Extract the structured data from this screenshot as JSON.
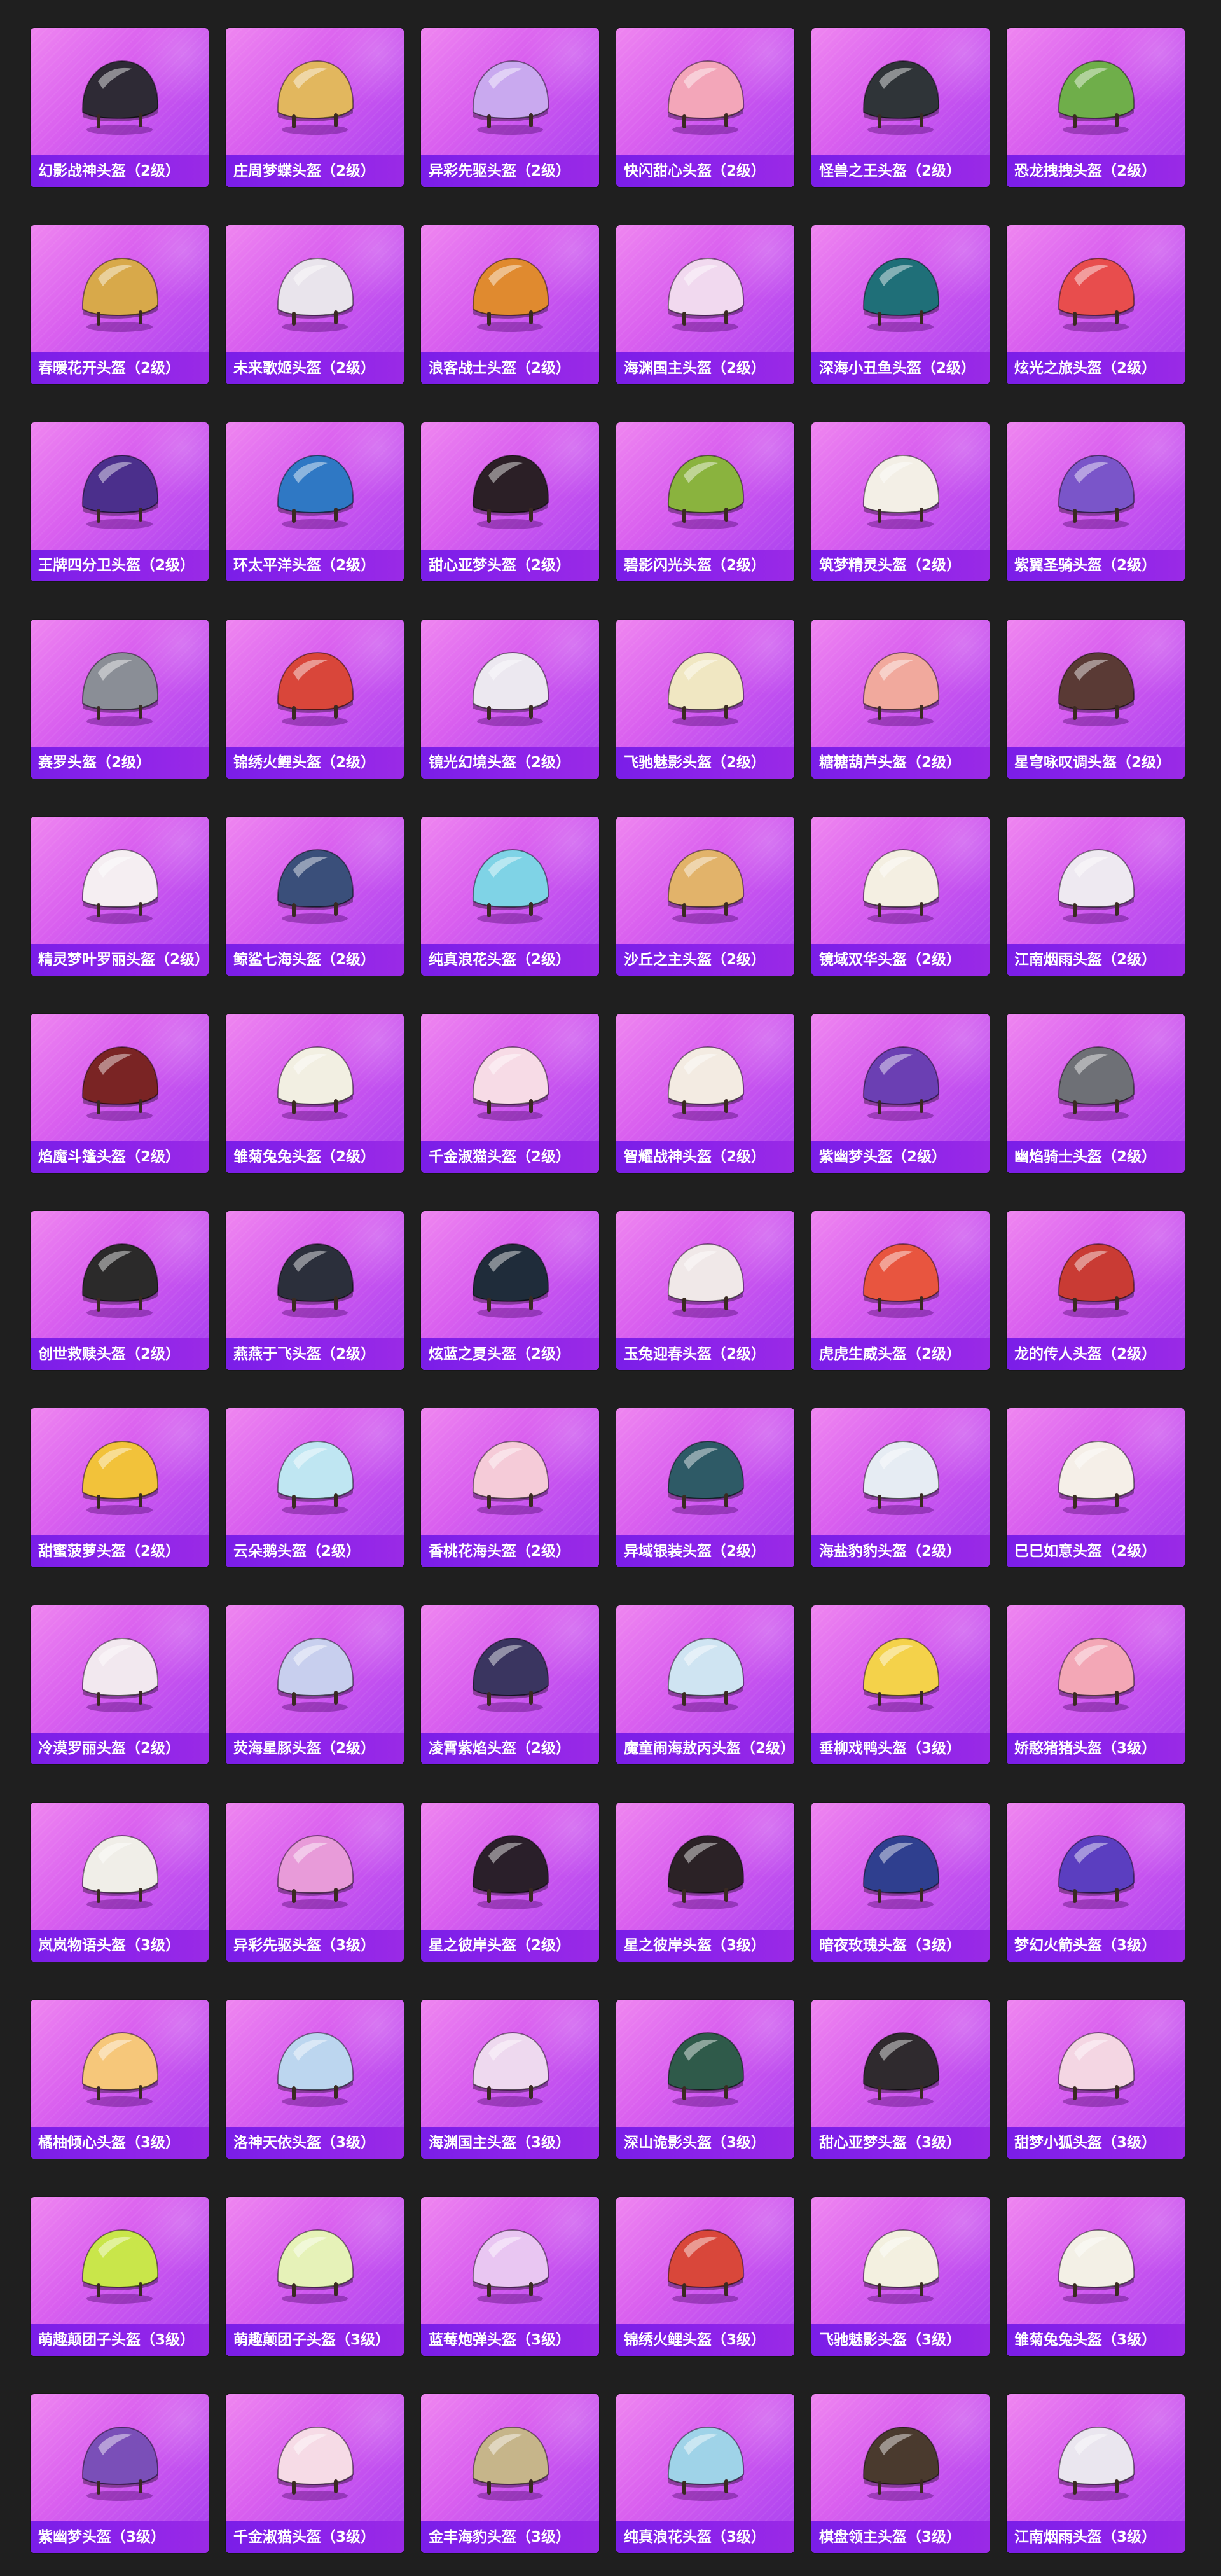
{
  "items": [
    {
      "name": "幻影战神头盔（2级）",
      "color": "#2e2a35"
    },
    {
      "name": "庄周梦蝶头盔（2级）",
      "color": "#e2b75e"
    },
    {
      "name": "异彩先驱头盔（2级）",
      "color": "#c9a9ef"
    },
    {
      "name": "快闪甜心头盔（2级）",
      "color": "#f3a6b9"
    },
    {
      "name": "怪兽之王头盔（2级）",
      "color": "#2f3438"
    },
    {
      "name": "恐龙拽拽头盔（2级）",
      "color": "#6fae4a"
    },
    {
      "name": "春暖花开头盔（2级）",
      "color": "#d8a94a"
    },
    {
      "name": "未来歌姬头盔（2级）",
      "color": "#e9e4ec"
    },
    {
      "name": "浪客战士头盔（2级）",
      "color": "#e08a2f"
    },
    {
      "name": "海渊国主头盔（2级）",
      "color": "#f1d9ef"
    },
    {
      "name": "深海小丑鱼头盔（2级）",
      "color": "#1f6f78"
    },
    {
      "name": "炫光之旅头盔（2级）",
      "color": "#e84d4d"
    },
    {
      "name": "王牌四分卫头盔（2级）",
      "color": "#4b2f8c"
    },
    {
      "name": "环太平洋头盔（2级）",
      "color": "#2f78c4"
    },
    {
      "name": "甜心亚梦头盔（2级）",
      "color": "#2b1f26"
    },
    {
      "name": "碧影闪光头盔（2级）",
      "color": "#8ab33e"
    },
    {
      "name": "筑梦精灵头盔（2级）",
      "color": "#f3efe6"
    },
    {
      "name": "紫翼圣骑头盔（2级）",
      "color": "#7a55c9"
    },
    {
      "name": "赛罗头盔（2级）",
      "color": "#8a8e96"
    },
    {
      "name": "锦绣火鲤头盔（2级）",
      "color": "#d9463a"
    },
    {
      "name": "镜光幻境头盔（2级）",
      "color": "#ece8f0"
    },
    {
      "name": "飞驰魅影头盔（2级）",
      "color": "#f0e7c2"
    },
    {
      "name": "糖糖葫芦头盔（2级）",
      "color": "#f1a99d"
    },
    {
      "name": "星穹咏叹调头盔（2级）",
      "color": "#5a3a35"
    },
    {
      "name": "精灵梦叶罗丽头盔（2级）",
      "color": "#f5eef2"
    },
    {
      "name": "鲸鲨七海头盔（2级）",
      "color": "#3a4f7a"
    },
    {
      "name": "纯真浪花头盔（2级）",
      "color": "#7fd3e6"
    },
    {
      "name": "沙丘之主头盔（2级）",
      "color": "#e2b36a"
    },
    {
      "name": "镜域双华头盔（2级）",
      "color": "#f4efe2"
    },
    {
      "name": "江南烟雨头盔（2级）",
      "color": "#eee9f1"
    },
    {
      "name": "焰魔斗篷头盔（2级）",
      "color": "#7a2424"
    },
    {
      "name": "雏菊兔兔头盔（2级）",
      "color": "#f2efe2"
    },
    {
      "name": "千金淑猫头盔（2级）",
      "color": "#f7dbe6"
    },
    {
      "name": "智耀战神头盔（2级）",
      "color": "#f3ebe2"
    },
    {
      "name": "紫幽梦头盔（2级）",
      "color": "#6b3fb3"
    },
    {
      "name": "幽焰骑士头盔（2级）",
      "color": "#6e7076"
    },
    {
      "name": "创世救赎头盔（2级）",
      "color": "#2b2a2a"
    },
    {
      "name": "燕燕于飞头盔（2级）",
      "color": "#2b2f3b"
    },
    {
      "name": "炫蓝之夏头盔（2级）",
      "color": "#1f2c3a"
    },
    {
      "name": "玉兔迎春头盔（2级）",
      "color": "#f0e8e8"
    },
    {
      "name": "虎虎生威头盔（2级）",
      "color": "#e8553f"
    },
    {
      "name": "龙的传人头盔（2级）",
      "color": "#c93b34"
    },
    {
      "name": "甜蜜菠萝头盔（2级）",
      "color": "#f2c23a"
    },
    {
      "name": "云朵鹅头盔（2级）",
      "color": "#bfe6f2"
    },
    {
      "name": "香桃花海头盔（2级）",
      "color": "#f5cbd8"
    },
    {
      "name": "异域银装头盔（2级）",
      "color": "#2e5a66"
    },
    {
      "name": "海盐豹豹头盔（2级）",
      "color": "#e6ecf3"
    },
    {
      "name": "巳巳如意头盔（2级）",
      "color": "#f5efe8"
    },
    {
      "name": "冷漠罗丽头盔（2级）",
      "color": "#f2e8ef"
    },
    {
      "name": "荧海星豚头盔（2级）",
      "color": "#c8cfee"
    },
    {
      "name": "凌霄紫焰头盔（2级）",
      "color": "#3a3560"
    },
    {
      "name": "魔童闹海敖丙头盔（2级）",
      "color": "#cfe4f2"
    },
    {
      "name": "垂柳戏鸭头盔（3级）",
      "color": "#f4d24a"
    },
    {
      "name": "娇憨猪猪头盔（3级）",
      "color": "#f3a7b6"
    },
    {
      "name": "岚岚物语头盔（3级）",
      "color": "#f0eee8"
    },
    {
      "name": "异彩先驱头盔（3级）",
      "color": "#e89bd9"
    },
    {
      "name": "星之彼岸头盔（2级）",
      "color": "#2a1f2a"
    },
    {
      "name": "星之彼岸头盔（3级）",
      "color": "#2b2226"
    },
    {
      "name": "暗夜玫瑰头盔（3级）",
      "color": "#2f3f8f"
    },
    {
      "name": "梦幻火箭头盔（3级）",
      "color": "#5b3ec0"
    },
    {
      "name": "橘柚倾心头盔（3级）",
      "color": "#f6c77a"
    },
    {
      "name": "洛神天依头盔（3级）",
      "color": "#bcd6ef"
    },
    {
      "name": "海渊国主头盔（3级）",
      "color": "#eed9ef"
    },
    {
      "name": "深山诡影头盔（3级）",
      "color": "#2f5a4a"
    },
    {
      "name": "甜心亚梦头盔（3级）",
      "color": "#2f2a2e"
    },
    {
      "name": "甜梦小狐头盔（3级）",
      "color": "#f4d6e3"
    },
    {
      "name": "萌趣颠团子头盔（3级）",
      "color": "#c9e64a"
    },
    {
      "name": "萌趣颠团子头盔（3级）",
      "color": "#e6f2b8"
    },
    {
      "name": "蓝莓炮弹头盔（3级）",
      "color": "#e9c6f2"
    },
    {
      "name": "锦绣火鲤头盔（3级）",
      "color": "#d9473a"
    },
    {
      "name": "飞驰魅影头盔（3级）",
      "color": "#f3f0e0"
    },
    {
      "name": "雏菊兔兔头盔（3级）",
      "color": "#f3f0e6"
    },
    {
      "name": "紫幽梦头盔（3级）",
      "color": "#7a4fb8"
    },
    {
      "name": "千金淑猫头盔（3级）",
      "color": "#f6dbe6"
    },
    {
      "name": "金丰海豹头盔（3级）",
      "color": "#c6b58a"
    },
    {
      "name": "纯真浪花头盔（3级）",
      "color": "#9fd3e8"
    },
    {
      "name": "棋盘领主头盔（3级）",
      "color": "#4a3a2e"
    },
    {
      "name": "江南烟雨头盔（3级）",
      "color": "#eae6ef"
    }
  ]
}
